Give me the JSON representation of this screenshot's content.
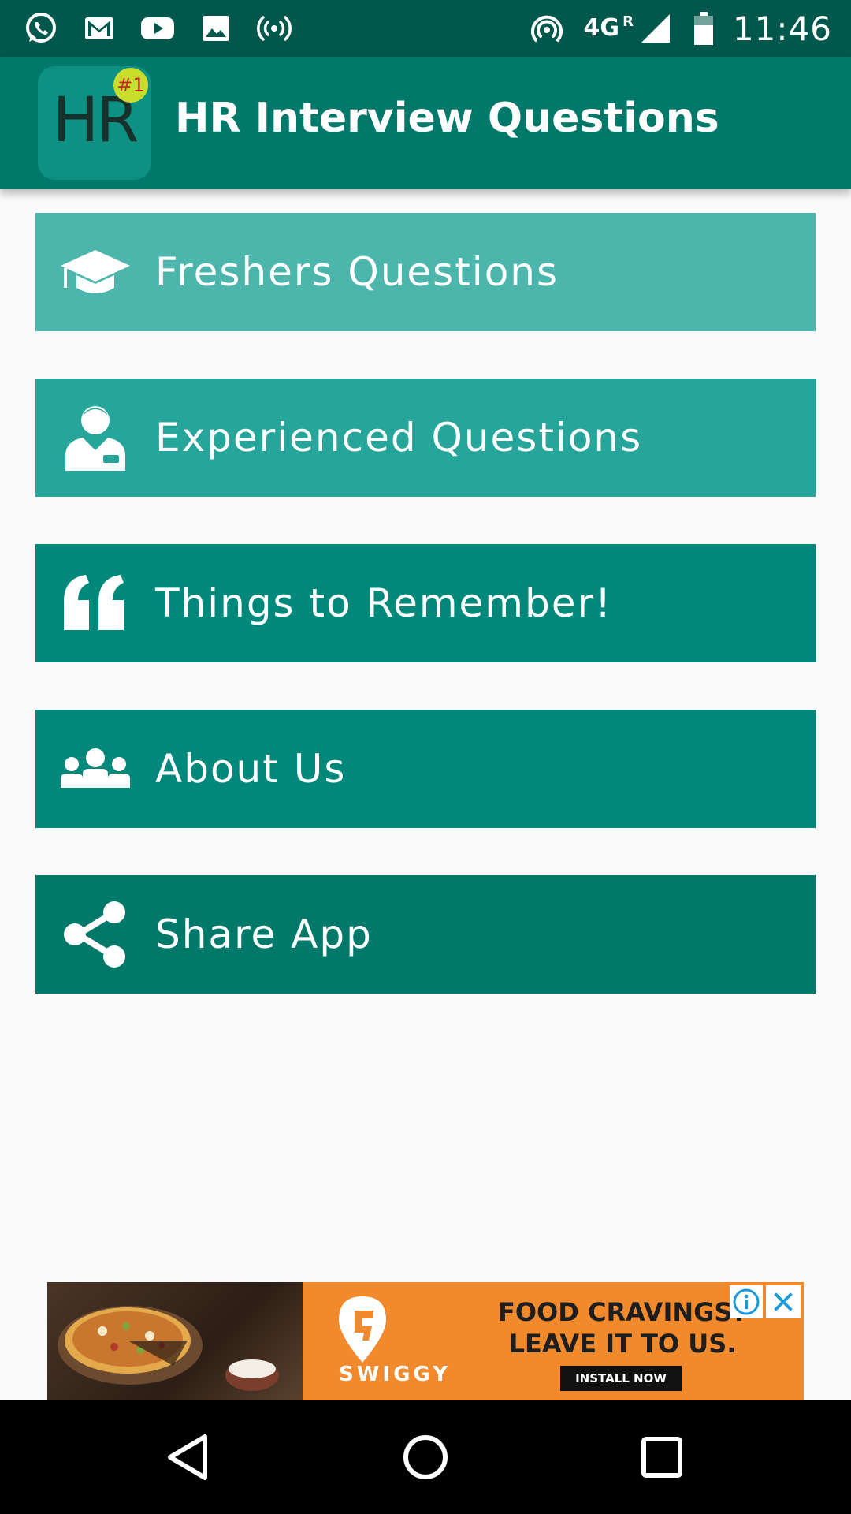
{
  "status_bar": {
    "left_icons": [
      "whatsapp-icon",
      "gmail-icon",
      "youtube-icon",
      "gallery-icon",
      "broadcast-icon"
    ],
    "right_icons": [
      "hotspot-icon",
      "network-4g-icon",
      "signal-icon",
      "battery-icon"
    ],
    "network_type": "4G",
    "roaming": "R",
    "time": "11:46"
  },
  "app_bar": {
    "logo_text": "HR",
    "logo_badge": "#1",
    "title": "HR Interview Questions"
  },
  "menu": {
    "items": [
      {
        "label": "Freshers Questions",
        "icon": "graduation-cap-icon",
        "color": "#4DB6AC"
      },
      {
        "label": "Experienced Questions",
        "icon": "professional-user-icon",
        "color": "#26A69A"
      },
      {
        "label": "Things to Remember!",
        "icon": "quote-icon",
        "color": "#00897B"
      },
      {
        "label": "About Us",
        "icon": "group-icon",
        "color": "#00897B"
      },
      {
        "label": "Share App",
        "icon": "share-icon",
        "color": "#00796B"
      }
    ]
  },
  "ad": {
    "brand": "SWIGGY",
    "headline_line1": "FOOD CRAVINGS?",
    "headline_line2": "LEAVE IT TO US.",
    "cta": "INSTALL NOW",
    "background_color": "#F08A2C"
  },
  "nav_bar": {
    "buttons": [
      "back-icon",
      "home-icon",
      "recents-icon"
    ]
  },
  "colors": {
    "status_bar": "#00574B",
    "app_bar": "#00796B",
    "background": "#FAFAFA"
  }
}
